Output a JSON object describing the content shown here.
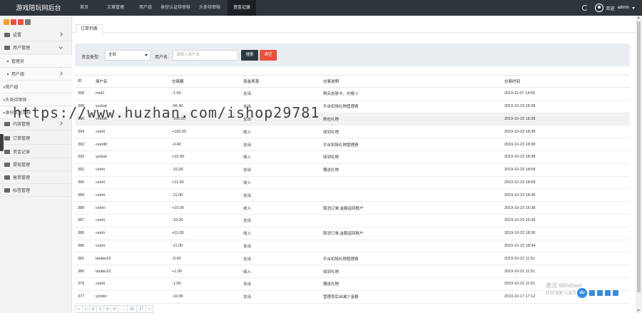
{
  "app": {
    "title": "游戏陪玩网后台"
  },
  "topnav": [
    {
      "label": "首页",
      "active": false
    },
    {
      "label": "文章管理",
      "active": false
    },
    {
      "label": "用户组",
      "active": false
    },
    {
      "label": "身份认证待审核",
      "active": false
    },
    {
      "label": "头条待审核",
      "active": false
    },
    {
      "label": "资金记录",
      "active": true
    }
  ],
  "user": {
    "welcome": "欢迎",
    "name": "admin"
  },
  "quick_colors": [
    "#f0a030",
    "#e8513c",
    "#e8513c",
    "#7a7a7a"
  ],
  "sidebar": {
    "items": [
      {
        "label": "设置",
        "icon": "gear-icon",
        "type": "group"
      },
      {
        "label": "用户管理",
        "icon": "users-icon",
        "type": "group-open"
      },
      {
        "label": "管理员",
        "icon": "",
        "type": "sub"
      },
      {
        "label": "用户组",
        "icon": "",
        "type": "sub"
      },
      {
        "label": "»用户组",
        "icon": "",
        "type": "sub2"
      },
      {
        "label": "»头条待审核",
        "icon": "",
        "type": "sub2"
      },
      {
        "label": "»身份认证审核",
        "icon": "",
        "type": "sub2"
      },
      {
        "label": "内容管理",
        "icon": "grid-icon",
        "type": "group"
      },
      {
        "label": "订单管理",
        "icon": "file-icon",
        "type": "group"
      },
      {
        "label": "资金记录",
        "icon": "money-icon",
        "type": "group"
      },
      {
        "label": "提现管理",
        "icon": "hand-icon",
        "type": "group"
      },
      {
        "label": "留单管理",
        "icon": "reply-icon",
        "type": "group"
      },
      {
        "label": "标签管理",
        "icon": "list-icon",
        "type": "group"
      }
    ]
  },
  "tab": {
    "label": "订单列表"
  },
  "filter": {
    "type_label": "资金类型:",
    "type_value": "全部",
    "user_label": "用户名:",
    "user_placeholder": "请输入用户名",
    "search_label": "搜索",
    "clear_label": "清空"
  },
  "table": {
    "headers": [
      "ID",
      "用户名",
      "交易额",
      "资金来源",
      "交易说明",
      "交易时间"
    ],
    "rows": [
      [
        "399",
        "root1",
        "-1.00",
        "支出",
        "购买皮肤卡，价格:1",
        "2019-11-07 14:55"
      ],
      [
        "398",
        "yzckat",
        "-66.40",
        "支出",
        "平台扣除礼物管理费",
        "2019-10-23 18:38"
      ],
      [
        "396",
        "ceshi8",
        "-166.00",
        "支出",
        "刷包礼物",
        "2019-10-23 18:38"
      ],
      [
        "394",
        "ceshi",
        "+166.00",
        "收入",
        "收到礼物",
        "2019-10-23 18:38"
      ],
      [
        "393",
        "ceshi8",
        "-0.40",
        "支出",
        "平台扣除礼物管理费",
        "2019-10-23 18:38"
      ],
      [
        "392",
        "yzckat",
        "+16.00",
        "收入",
        "收到礼物",
        "2019-10-23 18:38"
      ],
      [
        "391",
        "ceshi",
        "-16.00",
        "支出",
        "赠送礼物",
        "2019-10-23 18:08"
      ],
      [
        "390",
        "ceshi",
        "+11.00",
        "收入",
        "",
        "2019-10-23 18:08"
      ],
      [
        "389",
        "ceshi",
        "-11.00",
        "支出",
        "",
        "2019-10-23 18:38"
      ],
      [
        "388",
        "ceshi",
        "+10.00",
        "收入",
        "取消订单,金额返回账户",
        "2019-10-23 16:38"
      ],
      [
        "387",
        "ceshi",
        "-10.00",
        "支出",
        "",
        "2019-10-23 15:39"
      ],
      [
        "386",
        "ceshi",
        "+11.00",
        "收入",
        "取消订单,金额返回账户",
        "2019-10-22 18:36"
      ],
      [
        "385",
        "ceshi",
        "-11.00",
        "支出",
        "",
        "2019-10-22 18:34"
      ],
      [
        "381",
        "taotao10",
        "-0.40",
        "支出",
        "平台扣除礼物管理费",
        "2019-10-21 11:51"
      ],
      [
        "380",
        "taotao10",
        "+1.00",
        "收入",
        "收到礼物",
        "2019-10-21 11:51"
      ],
      [
        "379",
        "ceshi",
        "-1.00",
        "支出",
        "赠送礼物",
        "2019-10-21 11:51"
      ],
      [
        "377",
        "yzckkr",
        "-10.00",
        "支出",
        "管理员后台减少金额",
        "2019-10-17 17:12"
      ]
    ]
  },
  "pager": [
    "«",
    "1",
    "2",
    "3",
    "4",
    "5",
    "...",
    "16",
    "17",
    "»"
  ],
  "watermark": "https://www.huzhan.com/ishop29781",
  "activation": {
    "line1": "激活 Windows",
    "line2": "转到\"设置\"以激活 Windows。"
  },
  "float_tools": {
    "du_label": "du"
  }
}
